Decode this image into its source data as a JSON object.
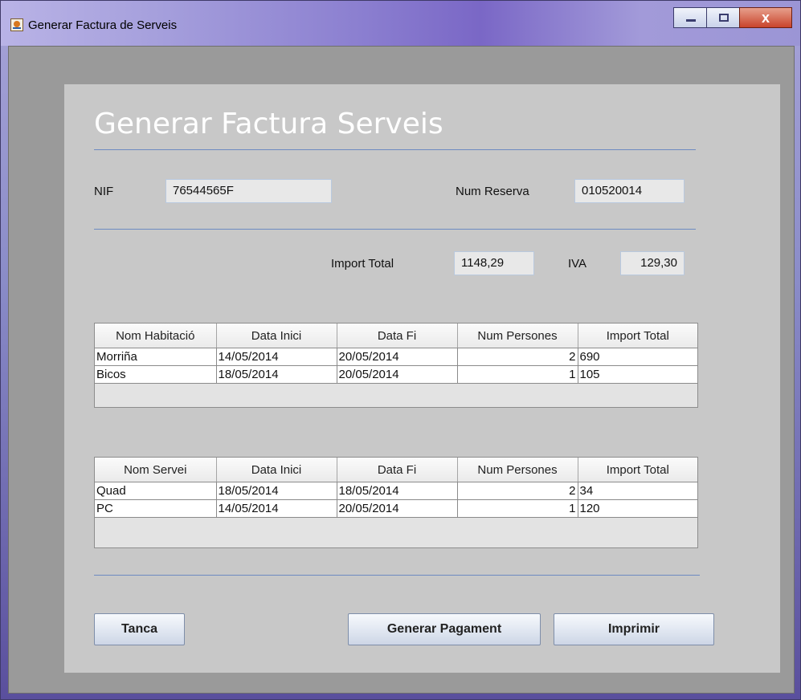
{
  "window": {
    "title": "Generar Factura de Serveis"
  },
  "form": {
    "heading": "Generar Factura Serveis",
    "nif_label": "NIF",
    "nif_value": "76544565F",
    "reserva_label": "Num Reserva",
    "reserva_value": "010520014",
    "import_label": "Import Total",
    "import_value": "1148,29",
    "iva_label": "IVA",
    "iva_value": "129,30"
  },
  "rooms_table": {
    "headers": [
      "Nom Habitació",
      "Data Inici",
      "Data Fi",
      "Num Persones",
      "Import Total"
    ],
    "rows": [
      [
        "Morriña",
        "14/05/2014",
        "20/05/2014",
        "2",
        "690"
      ],
      [
        "Bicos",
        "18/05/2014",
        "20/05/2014",
        "1",
        "105"
      ]
    ]
  },
  "services_table": {
    "headers": [
      "Nom Servei",
      "Data Inici",
      "Data Fi",
      "Num Persones",
      "Import Total"
    ],
    "rows": [
      [
        "Quad",
        "18/05/2014",
        "18/05/2014",
        "2",
        "34"
      ],
      [
        "PC",
        "14/05/2014",
        "20/05/2014",
        "1",
        "120"
      ]
    ]
  },
  "buttons": {
    "close": "Tanca",
    "payment": "Generar Pagament",
    "print": "Imprimir"
  }
}
